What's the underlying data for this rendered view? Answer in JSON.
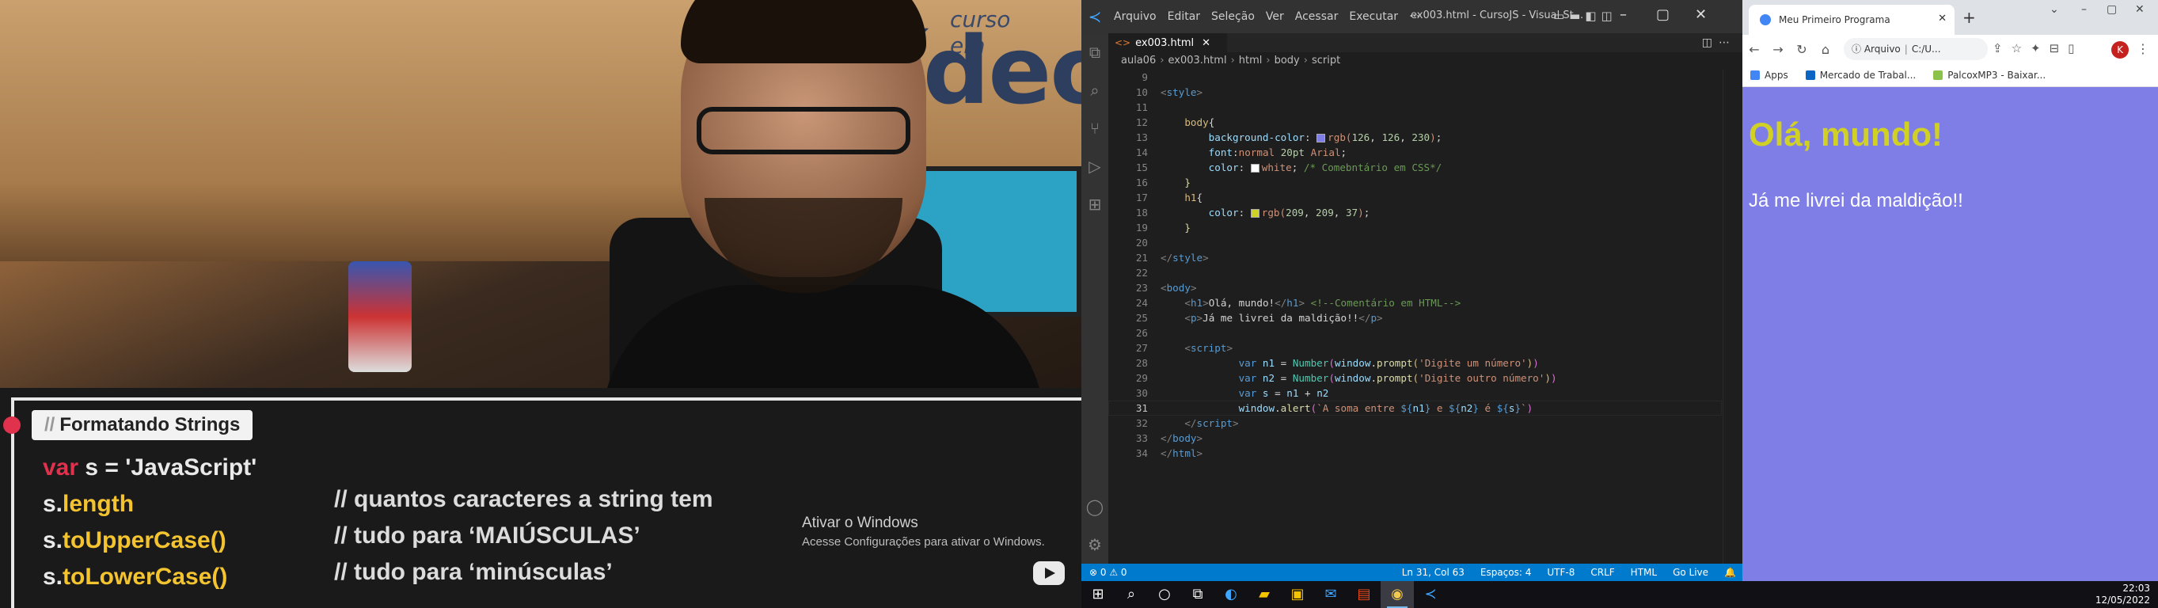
{
  "video": {
    "logo_small": "curso em",
    "logo_big": "Vídeo",
    "badge_slash": "//",
    "badge_title": "Formatando Strings",
    "code_lines": [
      {
        "kw": "var",
        "rest": " s = 'JavaScript'"
      },
      {
        "pre": "s.",
        "acc": "length",
        "comment": "// quantos caracteres a string tem"
      },
      {
        "pre": "s.",
        "acc": "toUpperCase()",
        "comment": "// tudo para ‘MAIÚSCULAS’"
      },
      {
        "pre": "s.",
        "acc": "toLowerCase()",
        "comment": "// tudo para ‘minúsculas’"
      }
    ],
    "watermark_title": "Ativar o Windows",
    "watermark_sub": "Acesse Configurações para ativar o Windows."
  },
  "vscode": {
    "menu": [
      "Arquivo",
      "Editar",
      "Seleção",
      "Ver",
      "Acessar",
      "Executar",
      "···"
    ],
    "window_title": "ex003.html - CursoJS - Visual St...",
    "tab_label": "ex003.html",
    "breadcrumb": [
      "aula06",
      "ex003.html",
      "html",
      "body",
      "script"
    ],
    "statusbar_left": "⊗ 0 ⚠ 0",
    "statusbar_right": [
      "Ln 31, Col 63",
      "Espaços: 4",
      "UTF-8",
      "CRLF",
      "HTML",
      "Go Live"
    ],
    "line_numbers": [
      "9",
      "10",
      "11",
      "12",
      "13",
      "14",
      "15",
      "16",
      "17",
      "18",
      "19",
      "20",
      "21",
      "22",
      "23",
      "24",
      "25",
      "26",
      "27",
      "28",
      "29",
      "30",
      "31",
      "32",
      "33",
      "34"
    ],
    "colors": {
      "body_bg": "#7e7ee6",
      "h1": "#d1d125",
      "white": "#ffffff"
    }
  },
  "chrome": {
    "tab_title": "Meu Primeiro Programa",
    "omnibox_scheme": "Arquivo",
    "omnibox_url": "C:/U...",
    "bookmarks": [
      "Apps",
      "Mercado de Trabal...",
      "PalcoxMP3 - Baixar..."
    ],
    "profile_initial": "K",
    "page_h1": "Olá, mundo!",
    "page_p": "Já me livrei da maldição!!"
  },
  "taskbar": {
    "time": "22:03",
    "date": "12/05/2022"
  }
}
